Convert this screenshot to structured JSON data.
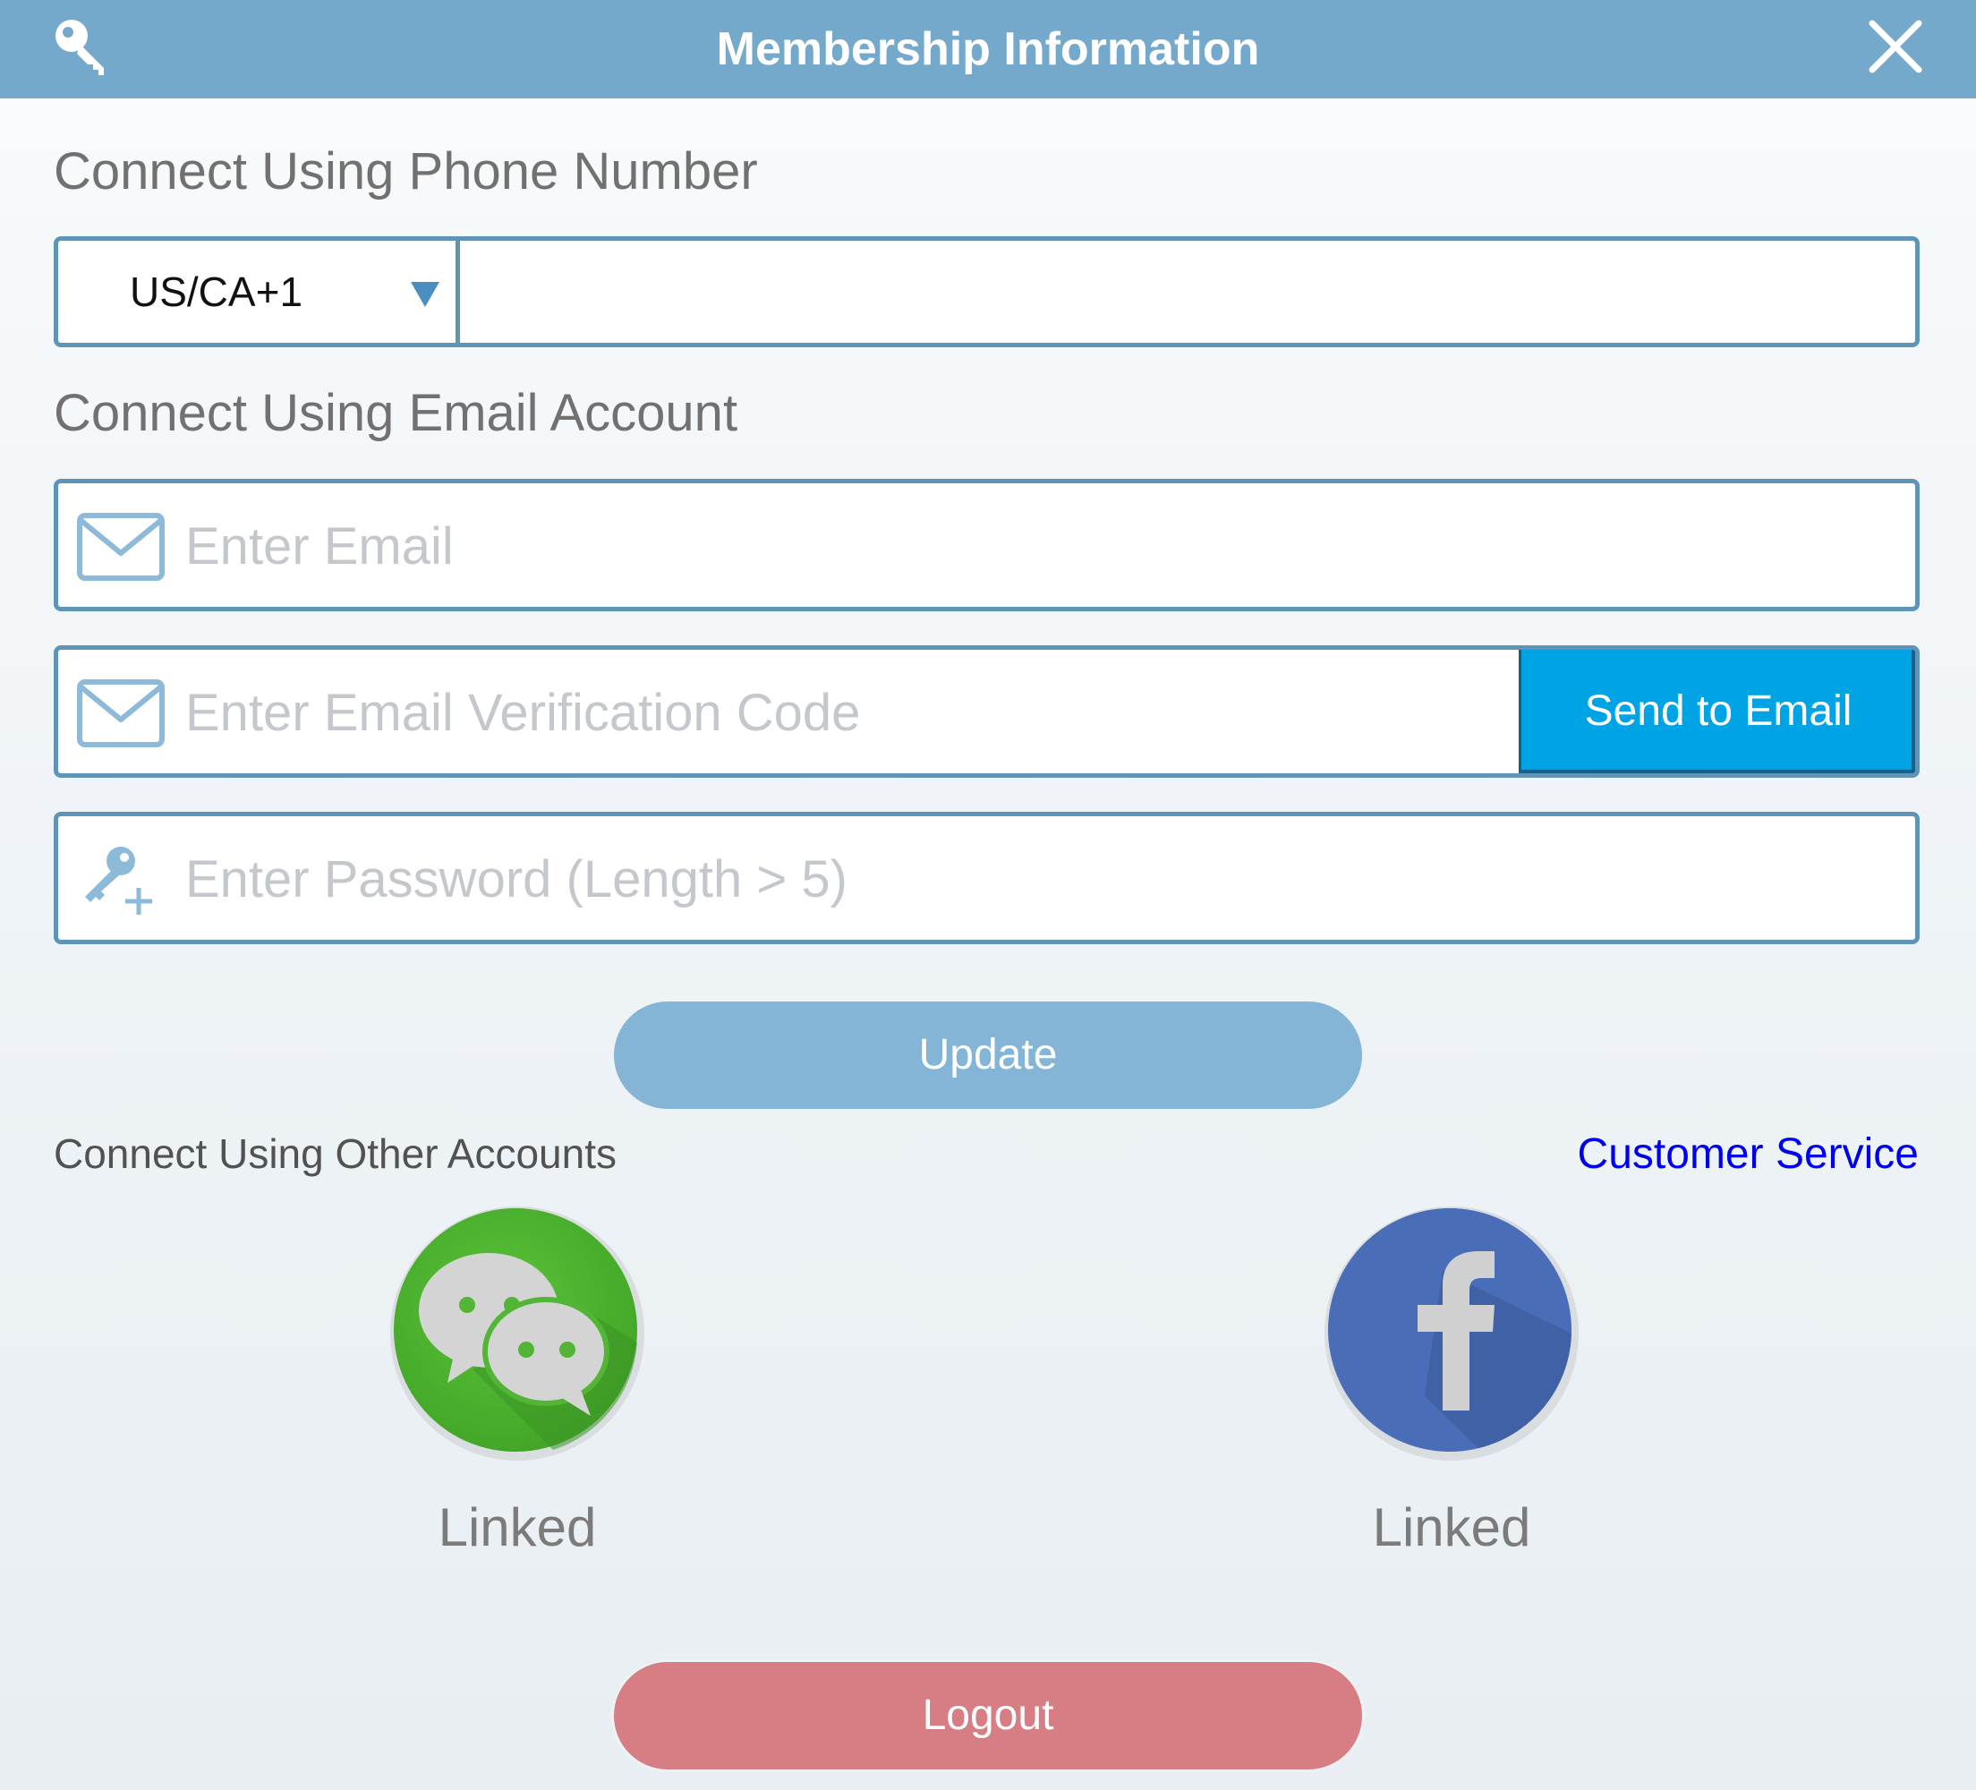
{
  "header": {
    "title": "Membership Information",
    "left_icon": "key-icon",
    "close_icon": "close-icon",
    "color": "#74a9cb"
  },
  "phone_section": {
    "label": "Connect Using Phone Number",
    "country_code": "US/CA+1",
    "dropdown_icon": "triangle-down-icon",
    "phone_value": ""
  },
  "email_section": {
    "label": "Connect Using Email Account",
    "email_placeholder": "Enter Email",
    "code_placeholder": "Enter Email Verification Code",
    "send_button": "Send to Email",
    "password_placeholder": "Enter Password (Length > 5)",
    "send_button_color": "#00a3e3"
  },
  "actions": {
    "update": "Update",
    "logout": "Logout",
    "update_color": "#84b5d6",
    "logout_color": "#d67e84"
  },
  "other_accounts": {
    "label": "Connect Using Other Accounts",
    "customer_service": "Customer Service",
    "accounts": [
      {
        "name": "WeChat",
        "icon": "wechat-icon",
        "status": "Linked",
        "color": "#52b535"
      },
      {
        "name": "Facebook",
        "icon": "facebook-icon",
        "status": "Linked",
        "color": "#4a6db8"
      }
    ]
  }
}
